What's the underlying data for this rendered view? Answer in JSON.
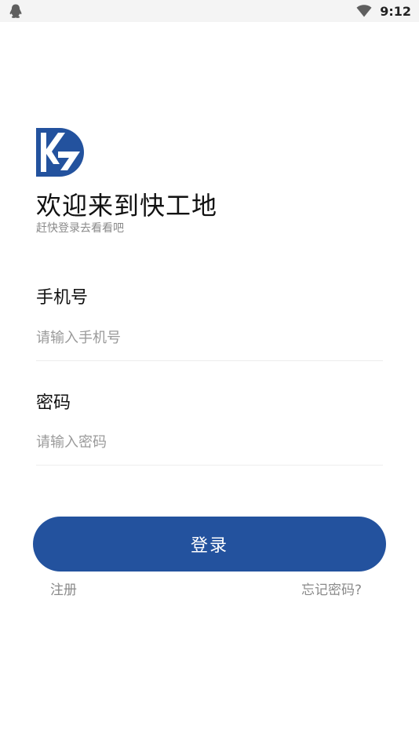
{
  "statusbar": {
    "time": "9:12",
    "left_icon": "qq-penguin-icon",
    "wifi_icon": "wifi-icon"
  },
  "brand": {
    "logo_icon": "kg-logo-icon",
    "accent_color": "#23529e"
  },
  "header": {
    "title": "欢迎来到快工地",
    "subtitle": "赶快登录去看看吧"
  },
  "form": {
    "phone": {
      "label": "手机号",
      "placeholder": "请输入手机号",
      "value": ""
    },
    "password": {
      "label": "密码",
      "placeholder": "请输入密码",
      "value": ""
    }
  },
  "actions": {
    "login_label": "登录",
    "register_label": "注册",
    "forgot_label": "忘记密码?"
  }
}
